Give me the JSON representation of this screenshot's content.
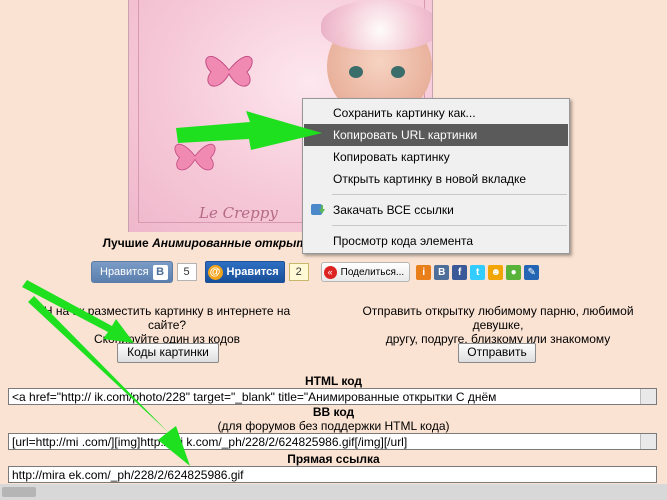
{
  "image": {
    "signature": "Le Creppy"
  },
  "caption": {
    "bold_prefix": "Лучшие ",
    "italic_part": "Анимированные открыт",
    "suffix": "о"
  },
  "social": {
    "vk_label": "Нравится",
    "vk_badge": "В",
    "vk_count": "5",
    "mail_label": "Нравится",
    "mail_badge": "@",
    "mail_count": "2",
    "share_label": "Поделиться..."
  },
  "left_block": {
    "line1": "Н  на  ак разместить картинку в интернете на",
    "line2": "сайте?",
    "line3": "Скопируйте один из кодов",
    "button": "Коды картинки"
  },
  "right_block": {
    "line1": "Отправить открытку любимому парню, любимой",
    "line2": "девушке,",
    "line3": "другу, подруге, близкому или знакомому",
    "button": "Отправить"
  },
  "html_code": {
    "title": "HTML код",
    "value": "<a href=\"http://                  ik.com/photo/228\" target=\"_blank\" title=\"Анимированные открытки С днём"
  },
  "bb_code": {
    "title": "BB код",
    "subtitle": "(для форумов без поддержки HTML кода)",
    "value": "[url=http://mi                    .com/][img]http://mi            k.com/_ph/228/2/624825986.gif[/img][/url]"
  },
  "direct_link": {
    "title": "Прямая ссылка",
    "value": "http://mira                 ek.com/_ph/228/2/624825986.gif"
  },
  "context_menu": {
    "items": [
      "Сохранить картинку как...",
      "Копировать URL картинки",
      "Копировать картинку",
      "Открыть картинку в новой вкладке",
      "Закачать ВСЕ ссылки",
      "Просмотр кода элемента"
    ],
    "highlighted_index": 1
  },
  "colors": {
    "page_bg": "#fbe3d3",
    "menu_highlight": "#5a5a5a",
    "arrow": "#1fe01f"
  }
}
